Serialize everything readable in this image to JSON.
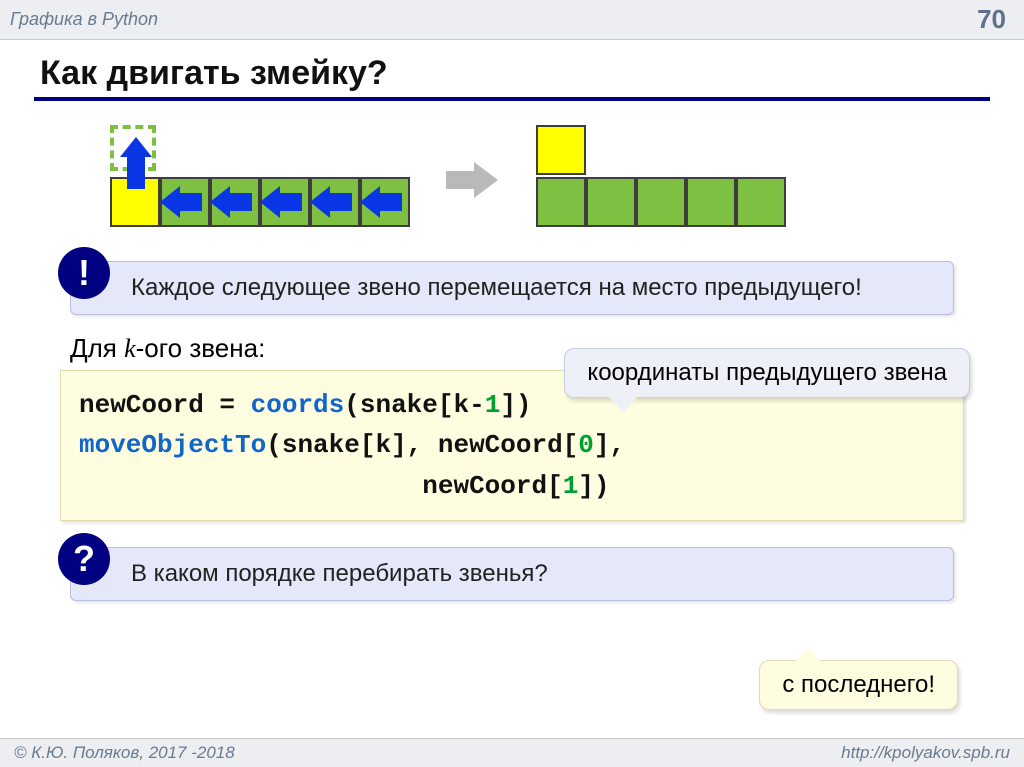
{
  "header": {
    "left": "Графика в Python",
    "page": "70"
  },
  "title": "Как двигать змейку?",
  "info1": {
    "badge": "!",
    "text": "Каждое следующее звено перемещается на место предыдущего!"
  },
  "subtitle": {
    "pre": "Для ",
    "k": "k",
    "post": "-ого звена:"
  },
  "code": {
    "line1a": "newCoord = ",
    "line1b": "coords",
    "line1c": "(snake[k-",
    "line1d": "1",
    "line1e": "])",
    "line2a": "moveObjectTo",
    "line2b": "(snake[k], newCoord[",
    "line2c": "0",
    "line2d": "],",
    "line3a": "                      newCoord[",
    "line3b": "1",
    "line3c": "])"
  },
  "callout_coords": "координаты предыдущего звена",
  "info2": {
    "badge": "?",
    "text": "В каком порядке перебирать звенья?"
  },
  "callout_answer": "с последнего!",
  "footer": {
    "left": "© К.Ю. Поляков, 2017 -2018",
    "right": "http://kpolyakov.spb.ru"
  }
}
